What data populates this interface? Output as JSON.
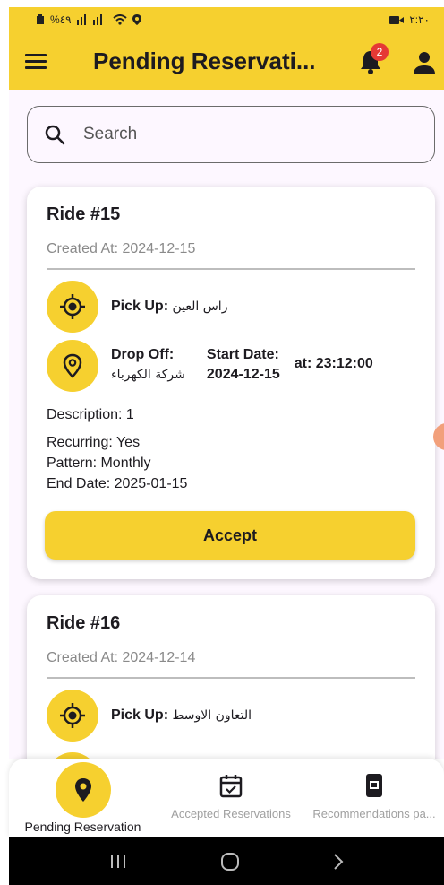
{
  "status_bar": {
    "left_text": "%٤٩",
    "right_text": "٢:٢٠"
  },
  "app_bar": {
    "title": "Pending Reservati...",
    "notification_count": "2"
  },
  "search": {
    "placeholder": "Search"
  },
  "reservations": [
    {
      "title": "Ride #15",
      "created": "Created At: 2024-12-15",
      "pickup_label": "Pick Up:",
      "pickup_value": "راس العين",
      "dropoff_label": "Drop Off:",
      "dropoff_value": "شركة الكهرباء",
      "start_label": "Start Date:",
      "start_value": "2024-12-15",
      "time": "at: 23:12:00",
      "description": "Description: 1",
      "recurring": "Recurring: Yes",
      "pattern": "Pattern: Monthly",
      "end_date": "End Date: 2025-01-15",
      "accept_label": "Accept"
    },
    {
      "title": "Ride #16",
      "created": "Created At: 2024-12-14",
      "pickup_label": "Pick Up:",
      "pickup_value": "التعاون الاوسط"
    }
  ],
  "bottom_nav": {
    "items": [
      {
        "label": "Pending Reservation",
        "icon": "location-pin-icon",
        "active": true
      },
      {
        "label": "Accepted Reservations",
        "icon": "calendar-check-icon",
        "active": false
      },
      {
        "label": "Recommendations pa...",
        "icon": "ticket-icon",
        "active": false
      }
    ]
  },
  "colors": {
    "primary": "#f6d02f",
    "badge": "#e53935",
    "background": "#fdf7ff"
  }
}
